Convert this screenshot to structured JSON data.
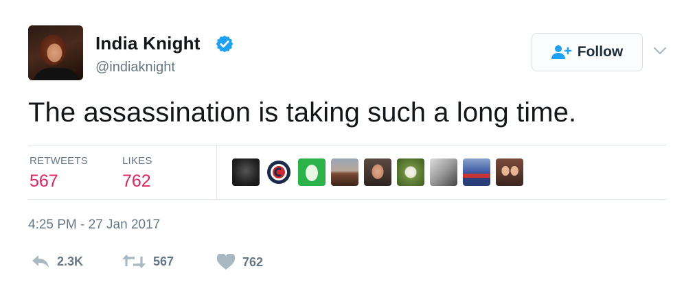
{
  "author": {
    "name": "India Knight",
    "handle": "@indiaknight",
    "verified": true
  },
  "follow_button": {
    "label": "Follow"
  },
  "tweet": {
    "text": "The assassination is taking such a long time."
  },
  "stats": {
    "retweets_label": "RETWEETS",
    "retweets_value": "567",
    "likes_label": "LIKES",
    "likes_value": "762"
  },
  "liker_avatars": [
    "avatar-1",
    "avatar-2",
    "avatar-3",
    "avatar-4",
    "avatar-5",
    "avatar-6",
    "avatar-7",
    "avatar-8",
    "avatar-9"
  ],
  "timestamp": "4:25 PM - 27 Jan 2017",
  "actions": {
    "reply_count": "2.3K",
    "retweet_count": "567",
    "like_count": "762"
  },
  "colors": {
    "accent": "#1da1f2",
    "likes": "#e0245e",
    "secondary_text": "#657786"
  }
}
